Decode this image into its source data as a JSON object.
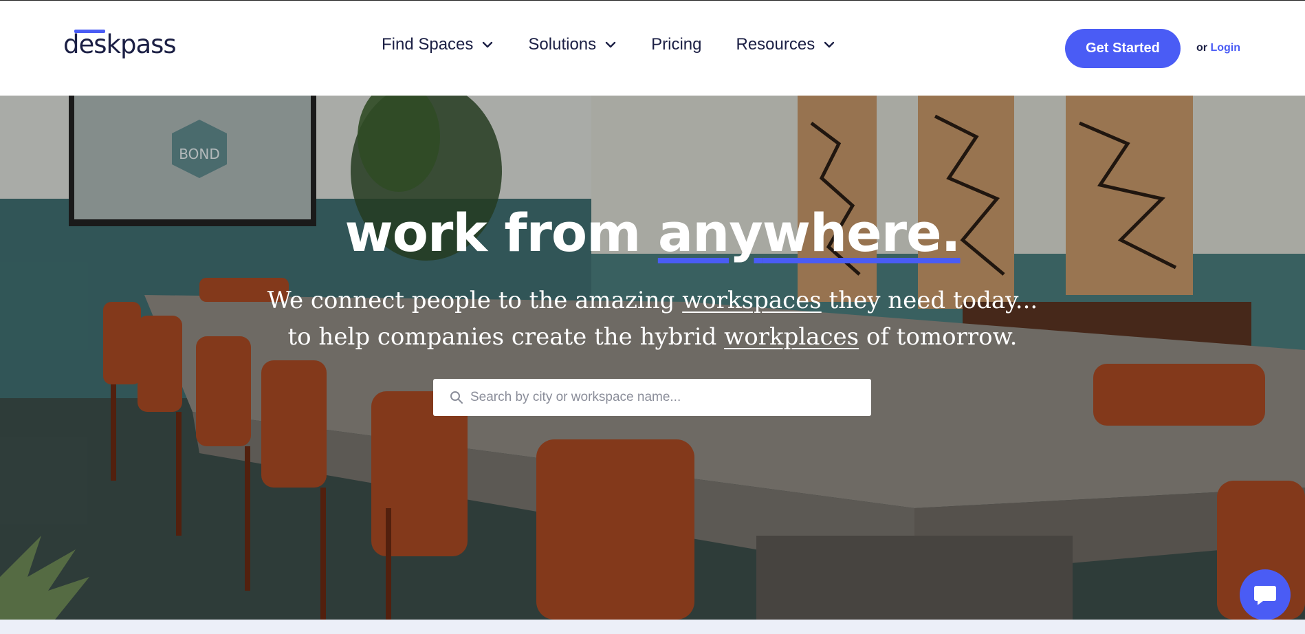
{
  "brand": {
    "logo_text": "deskpass",
    "accent": "#4a5cf5",
    "dark": "#1b1f44"
  },
  "nav": {
    "items": [
      {
        "label": "Find Spaces",
        "dropdown": true
      },
      {
        "label": "Solutions",
        "dropdown": true
      },
      {
        "label": "Pricing",
        "dropdown": false
      },
      {
        "label": "Resources",
        "dropdown": true
      }
    ]
  },
  "header": {
    "cta_label": "Get Started",
    "or_text": "or",
    "login_label": "Login"
  },
  "hero": {
    "title_plain": "work from ",
    "title_emph_1": "any",
    "title_emph_gap": "",
    "title_emph_2": "where.",
    "sub_line1_a": "We connect people to the amazing ",
    "sub_line1_link": "workspaces",
    "sub_line1_b": " they need today...",
    "sub_line2_a": "to help companies create the hybrid ",
    "sub_line2_link": "workplaces",
    "sub_line2_b": " of tomorrow.",
    "photo_sign": "BOND"
  },
  "search": {
    "placeholder": "Search by city or workspace name...",
    "value": ""
  },
  "icons": {
    "search": "search-icon",
    "chevron": "chevron-down-icon",
    "chat": "chat-bubble-icon"
  }
}
